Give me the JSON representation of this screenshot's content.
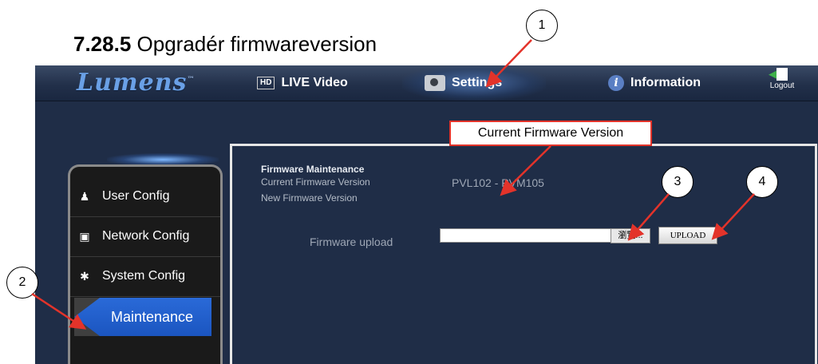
{
  "heading": {
    "number": "7.28.5",
    "title": "Opgradér firmwareversion"
  },
  "app": {
    "logo": "Lumens",
    "nav": {
      "live_hd": "HD",
      "live_label": "LIVE Video",
      "settings_label": "Settings",
      "info_label": "Information",
      "logout_label": "Logout"
    },
    "sidebar": {
      "items": [
        {
          "label": "User Config",
          "icon": "user-icon"
        },
        {
          "label": "Network Config",
          "icon": "monitor-icon"
        },
        {
          "label": "System Config",
          "icon": "gear-icon"
        }
      ],
      "active": "Maintenance"
    },
    "panel": {
      "title": "Firmware Maintenance",
      "current_label": "Current Firmware Version",
      "new_label": "New Firmware Version",
      "current_value": "PVL102 - PVM105",
      "upload_label": "Firmware upload",
      "file_value": "",
      "browse_label": "瀏覽...",
      "upload_button": "UPLOAD"
    }
  },
  "annotations": {
    "callout": "Current Firmware Version",
    "markers": [
      "1",
      "2",
      "3",
      "4"
    ]
  },
  "colors": {
    "callout_border": "#e3332a",
    "arrow": "#e3332a",
    "active_item": "#1b55c0"
  }
}
